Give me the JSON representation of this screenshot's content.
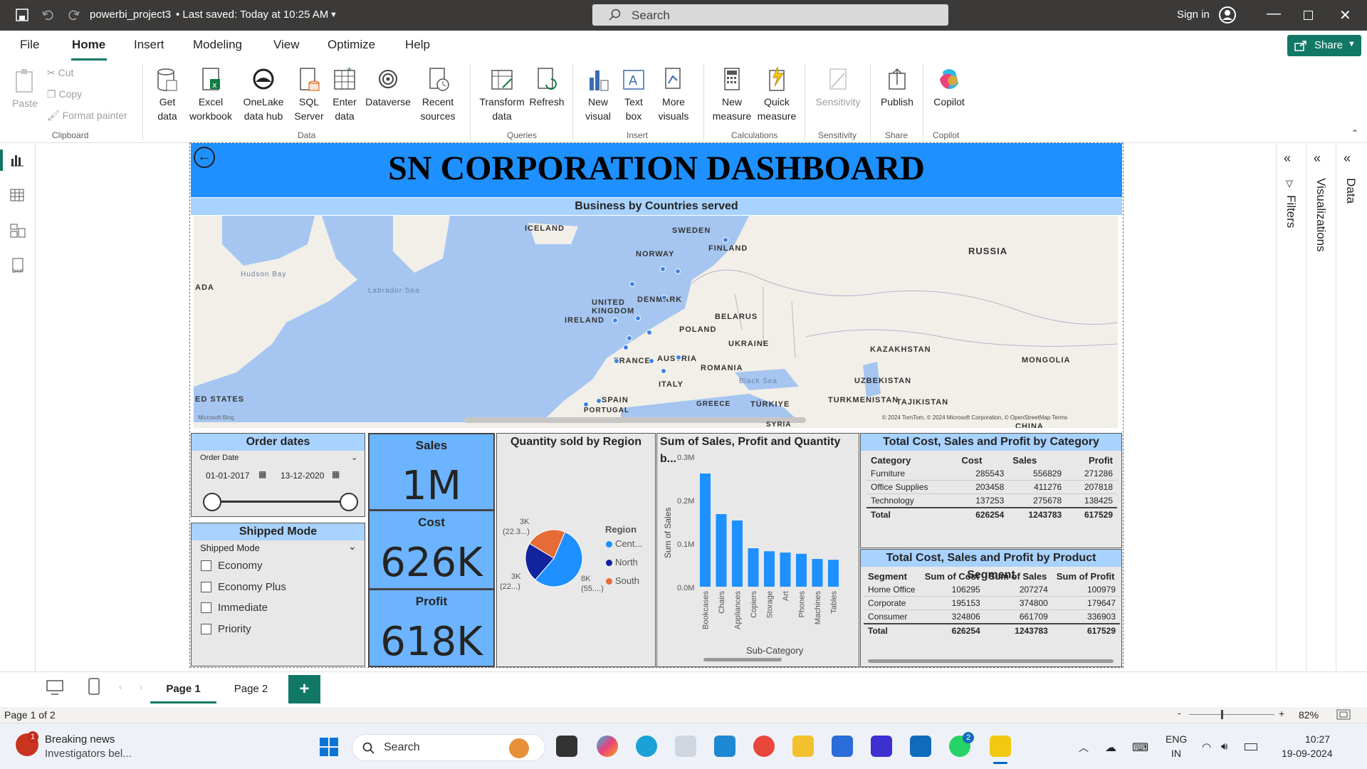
{
  "titlebar": {
    "file_title": "powerbi_project3",
    "saved": "• Last saved: Today at 10:25 AM",
    "search_placeholder": "Search",
    "sign_in": "Sign in"
  },
  "menu": {
    "items": [
      "File",
      "Home",
      "Insert",
      "Modeling",
      "View",
      "Optimize",
      "Help"
    ],
    "share": "Share"
  },
  "ribbon": {
    "clipboard": {
      "paste": "Paste",
      "cut": "Cut",
      "copy": "Copy",
      "format_painter": "Format painter",
      "group": "Clipboard"
    },
    "data": {
      "get_data": "Get data",
      "excel": "Excel workbook",
      "onelake": "OneLake data hub",
      "sql": "SQL Server",
      "enter": "Enter data",
      "dataverse": "Dataverse",
      "recent": "Recent sources",
      "group": "Data"
    },
    "queries": {
      "transform": "Transform data",
      "refresh": "Refresh",
      "group": "Queries"
    },
    "insert": {
      "new_visual": "New visual",
      "text_box": "Text box",
      "more_visuals": "More visuals",
      "group": "Insert"
    },
    "calc": {
      "new_measure": "New measure",
      "quick_measure": "Quick measure",
      "group": "Calculations"
    },
    "sensitivity": {
      "label": "Sensitivity",
      "group": "Sensitivity"
    },
    "share": {
      "publish": "Publish",
      "group": "Share"
    },
    "copilot": {
      "label": "Copilot",
      "group": "Copilot"
    }
  },
  "report": {
    "title": "SN CORPORATION DASHBOARD",
    "map": {
      "title": "Business by Countries served",
      "labels": [
        "ICELAND",
        "SWEDEN",
        "FINLAND",
        "NORWAY",
        "RUSSIA",
        "DENMARK",
        "UNITED KINGDOM",
        "IRELAND",
        "BELARUS",
        "POLAND",
        "UKRAINE",
        "FRANCE",
        "AUSTRIA",
        "ROMANIA",
        "ITALY",
        "KAZAKHSTAN",
        "MONGOLIA",
        "UZBEKISTAN",
        "TURKMENISTAN",
        "TAJIKISTAN",
        "SPAIN",
        "PORTUGAL",
        "GREECE",
        "TÜRKIYE",
        "SYRIA",
        "CHINA",
        "ADA",
        "ED STATES"
      ],
      "water": [
        "Hudson Bay",
        "Labrador Sea",
        "Black Sea"
      ],
      "attribution": "© 2024 TomTom, © 2024 Microsoft Corporation, © OpenStreetMap  Terms",
      "bing": "Microsoft Bing"
    },
    "order_dates": {
      "title": "Order dates",
      "field": "Order Date",
      "start": "01-01-2017",
      "end": "13-12-2020"
    },
    "shipped_mode": {
      "title": "Shipped Mode",
      "field": "Shipped Mode",
      "options": [
        "Economy",
        "Economy Plus",
        "Immediate",
        "Priority"
      ]
    },
    "kpis": [
      {
        "label": "Sales",
        "value": "1M"
      },
      {
        "label": "Cost",
        "value": "626K"
      },
      {
        "label": "Profit",
        "value": "618K"
      }
    ],
    "pie": {
      "title": "Quantity sold by Region",
      "legend_title": "Region",
      "legend": [
        "Cent...",
        "North",
        "South"
      ],
      "labels": [
        "3K",
        "(22.3...)",
        "3K",
        "(22...)",
        "8K",
        "(55....)"
      ]
    },
    "bars": {
      "title": "Sum of Sales, Profit and Quantity b...",
      "ylabel": "Sum of Sales",
      "xlabel": "Sub-Category",
      "yticks": [
        "0.3M",
        "0.2M",
        "0.1M",
        "0.0M"
      ]
    },
    "cat_table": {
      "title": "Total Cost, Sales and Profit by Category",
      "headers": [
        "Category",
        "Cost",
        "Sales",
        "Profit"
      ],
      "rows": [
        [
          "Furniture",
          "285543",
          "556829",
          "271286"
        ],
        [
          "Office Supplies",
          "203458",
          "411276",
          "207818"
        ],
        [
          "Technology",
          "137253",
          "275678",
          "138425"
        ]
      ],
      "total": [
        "Total",
        "626254",
        "1243783",
        "617529"
      ]
    },
    "seg_table": {
      "title": "Total Cost, Sales and Profit by Product Segment",
      "headers": [
        "Segment",
        "Sum of Cost",
        "Sum of Sales",
        "Sum of Profit"
      ],
      "rows": [
        [
          "Home Office",
          "106295",
          "207274",
          "100979"
        ],
        [
          "Corporate",
          "195153",
          "374800",
          "179647"
        ],
        [
          "Consumer",
          "324806",
          "661709",
          "336903"
        ]
      ],
      "total": [
        "Total",
        "626254",
        "1243783",
        "617529"
      ]
    }
  },
  "chart_data": {
    "type": "bar",
    "title": "Sum of Sales, Profit and Quantity b...",
    "xlabel": "Sub-Category",
    "ylabel": "Sum of Sales",
    "ylim": [
      0,
      0.3
    ],
    "categories": [
      "Bookcases",
      "Chairs",
      "Appliances",
      "Copiers",
      "Storage",
      "Art",
      "Phones",
      "Machines",
      "Tables"
    ],
    "values": [
      0.265,
      0.17,
      0.155,
      0.09,
      0.083,
      0.08,
      0.077,
      0.065,
      0.063
    ],
    "color": "#1e90ff"
  },
  "pie_data": {
    "type": "pie",
    "series": [
      {
        "name": "Cent...",
        "value": 55,
        "color": "#1e90ff"
      },
      {
        "name": "North",
        "value": 22.3,
        "color": "#12239e"
      },
      {
        "name": "South",
        "value": 22.7,
        "color": "#e66c37"
      }
    ]
  },
  "pages": {
    "tabs": [
      "Page 1",
      "Page 2"
    ],
    "add": "+",
    "status": "Page 1 of 2",
    "zoom": "82%"
  },
  "panes": {
    "filters": "Filters",
    "visualizations": "Visualizations",
    "data": "Data"
  },
  "taskbar": {
    "news_title": "Breaking news",
    "news_sub": "Investigators bel...",
    "search": "Search",
    "lang1": "ENG",
    "lang2": "IN",
    "time": "10:27",
    "date": "19-09-2024",
    "badge": "1",
    "wa_badge": "2"
  }
}
